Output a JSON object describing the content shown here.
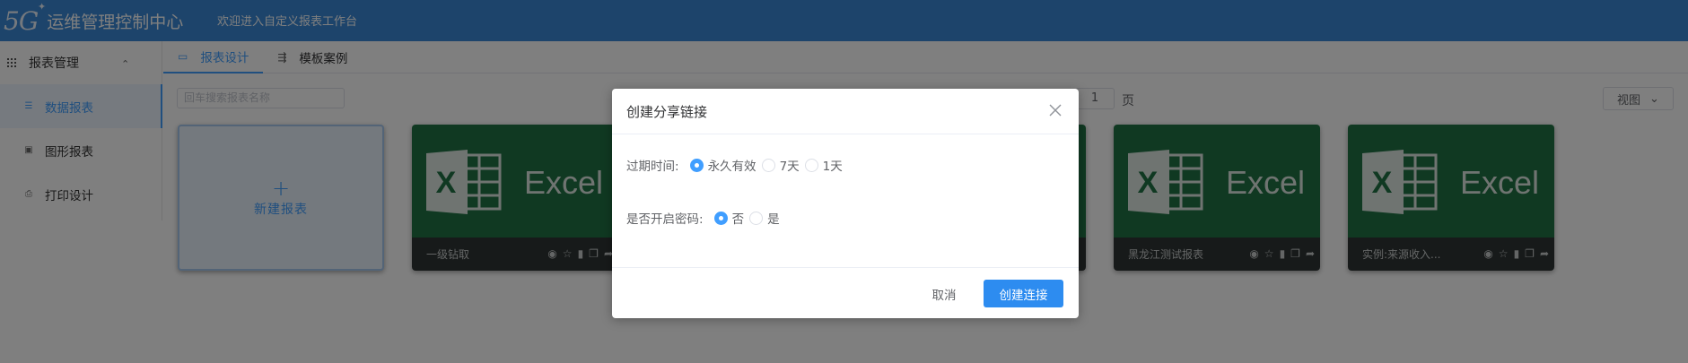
{
  "header": {
    "logo_mark": "5G",
    "app_title": "运维管理控制中心",
    "welcome": "欢迎进入自定义报表工作台"
  },
  "sidebar": {
    "group_label": "报表管理",
    "items": [
      {
        "label": "数据报表",
        "icon": "list-icon",
        "active": true
      },
      {
        "label": "图形报表",
        "icon": "image-icon",
        "active": false
      },
      {
        "label": "打印设计",
        "icon": "printer-icon",
        "active": false
      }
    ]
  },
  "tabs": [
    {
      "label": "报表设计",
      "icon": "monitor-icon",
      "active": true
    },
    {
      "label": "模板案例",
      "icon": "sliders-icon",
      "active": false
    }
  ],
  "toolbar": {
    "search_placeholder": "回车搜索报表名称",
    "page_value": "1",
    "page_unit": "页",
    "view_label": "视图"
  },
  "cards": {
    "new_label": "新建报表",
    "new_plus": "+",
    "excel_word": "Excel",
    "items": [
      {
        "name": "一级钻取"
      },
      {
        "name": "黑龙江测试报表"
      },
      {
        "name": "实例:来源收入..."
      }
    ],
    "action_icons": [
      "eye-icon",
      "star-icon",
      "trash-icon",
      "copy-icon",
      "share-icon"
    ]
  },
  "dialog": {
    "title": "创建分享链接",
    "expire_label": "过期时间:",
    "expire_options": [
      {
        "label": "永久有效",
        "checked": true
      },
      {
        "label": "7天",
        "checked": false
      },
      {
        "label": "1天",
        "checked": false
      }
    ],
    "password_label": "是否开启密码:",
    "password_options": [
      {
        "label": "否",
        "checked": true
      },
      {
        "label": "是",
        "checked": false
      }
    ],
    "cancel_label": "取消",
    "confirm_label": "创建连接"
  },
  "colors": {
    "header_bg": "#3a88d6",
    "accent": "#409eff",
    "excel_green": "#207245",
    "card_footer": "#2f3535"
  }
}
